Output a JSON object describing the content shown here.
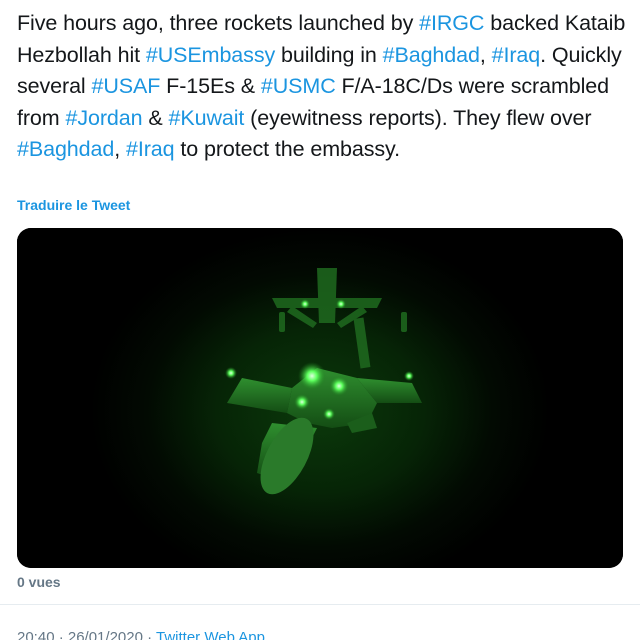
{
  "tweet": {
    "text_parts": [
      {
        "t": "Five hours ago, three rockets launched by ",
        "tag": false
      },
      {
        "t": "#IRGC",
        "tag": true
      },
      {
        "t": " backed Kataib Hezbollah hit ",
        "tag": false
      },
      {
        "t": "#USEmbassy",
        "tag": true
      },
      {
        "t": " building in ",
        "tag": false
      },
      {
        "t": "#Baghdad",
        "tag": true
      },
      {
        "t": ", ",
        "tag": false
      },
      {
        "t": "#Iraq",
        "tag": true
      },
      {
        "t": ". Quickly several ",
        "tag": false
      },
      {
        "t": "#USAF",
        "tag": true
      },
      {
        "t": " F-15Es & ",
        "tag": false
      },
      {
        "t": "#USMC",
        "tag": true
      },
      {
        "t": " F/A-18C/Ds were scrambled from ",
        "tag": false
      },
      {
        "t": "#Jordan",
        "tag": true
      },
      {
        "t": " & ",
        "tag": false
      },
      {
        "t": "#Kuwait",
        "tag": true
      },
      {
        "t": " (eyewitness reports). They flew over ",
        "tag": false
      },
      {
        "t": "#Baghdad",
        "tag": true
      },
      {
        "t": ", ",
        "tag": false
      },
      {
        "t": "#Iraq",
        "tag": true
      },
      {
        "t": " to protect the embassy.",
        "tag": false
      }
    ],
    "translate_label": "Traduire le Tweet",
    "views_label": "0 vues",
    "timestamp": "20:40 · 26/01/2020 · ",
    "source": "Twitter Web App"
  },
  "colors": {
    "text": "#14171a",
    "link": "#1b95e0",
    "secondary": "#657786",
    "night_vision_green": "#3cff3c"
  }
}
